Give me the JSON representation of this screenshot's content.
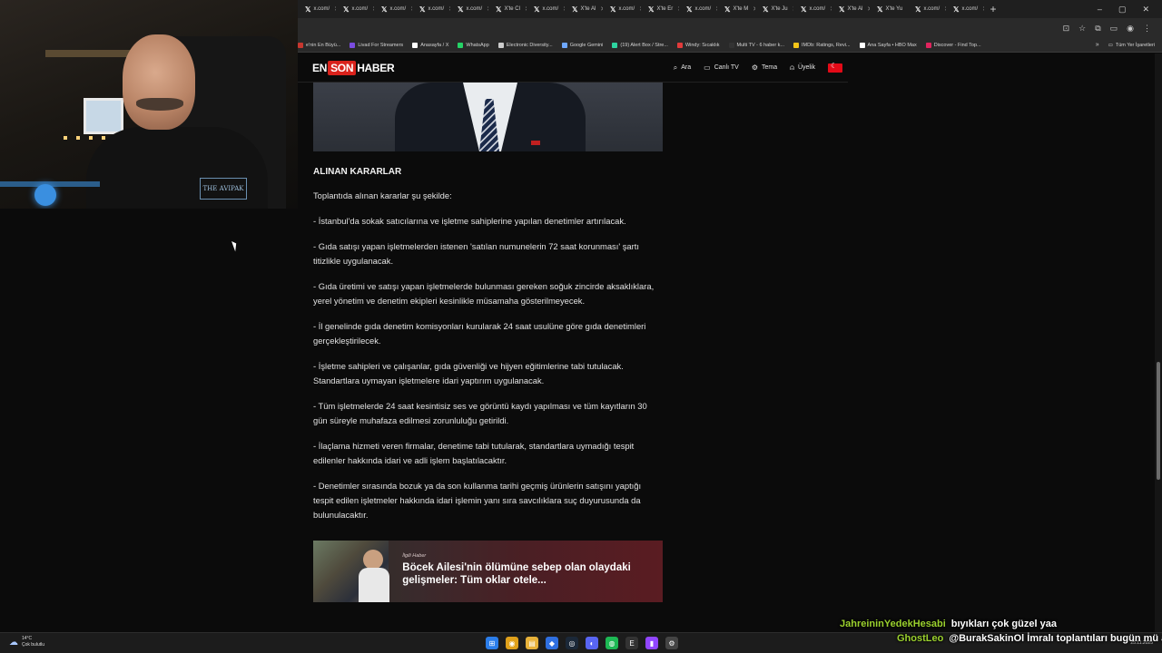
{
  "browser": {
    "tabs": [
      {
        "label": "x.com/"
      },
      {
        "label": "x.com/"
      },
      {
        "label": "x.com/"
      },
      {
        "label": "x.com/"
      },
      {
        "label": "x.com/"
      },
      {
        "label": "X'te Cl"
      },
      {
        "label": "x.com/"
      },
      {
        "label": "X'te Al"
      },
      {
        "label": "x.com/"
      },
      {
        "label": "X'te Er"
      },
      {
        "label": "x.com/"
      },
      {
        "label": "X'te M"
      },
      {
        "label": "X'te Ju"
      },
      {
        "label": "x.com/"
      },
      {
        "label": "X'te Al"
      },
      {
        "label": "X'te Yu"
      },
      {
        "label": "x.com/"
      },
      {
        "label": "x.com/"
      }
    ],
    "bookmarks": [
      {
        "label": "e'nin En Büyü...",
        "color": "#c7372f"
      },
      {
        "label": "Livad For Streamers",
        "color": "#7b4ce0"
      },
      {
        "label": "Anasayfa / X",
        "color": "#ffffff"
      },
      {
        "label": "WhatsApp",
        "color": "#25d366"
      },
      {
        "label": "Electronic Diversity...",
        "color": "#cccccc"
      },
      {
        "label": "Google Gemini",
        "color": "#6ea8ff"
      },
      {
        "label": "(19) Alert Box / Stre...",
        "color": "#2dd4a0"
      },
      {
        "label": "Windy: Sıcaklık",
        "color": "#e23b3b"
      },
      {
        "label": "Multi TV - 6 haber k...",
        "color": "#333333"
      },
      {
        "label": "IMDb: Ratings, Revi...",
        "color": "#f5c518"
      },
      {
        "label": "Ana Sayfa • HBO Max",
        "color": "#ffffff"
      },
      {
        "label": "Discover - Find Top...",
        "color": "#e0245e"
      }
    ],
    "all_bookmarks": "Tüm Yer İşaretleri"
  },
  "site": {
    "logo_en": "EN",
    "logo_son": "SON",
    "logo_haber": "HABER",
    "nav": [
      {
        "label": "Ara",
        "icon": "search-icon",
        "glyph": "⌕"
      },
      {
        "label": "Canlı TV",
        "icon": "tv-icon",
        "glyph": "▭"
      },
      {
        "label": "Tema",
        "icon": "gear-icon",
        "glyph": "⚙"
      },
      {
        "label": "Üyelik",
        "icon": "user-icon",
        "glyph": "⍝"
      }
    ]
  },
  "article": {
    "heading": "ALINAN KARARLAR",
    "intro": "Toplantıda alınan kararlar şu şekilde:",
    "items": [
      "- İstanbul'da sokak satıcılarına ve işletme sahiplerine yapılan denetimler artırılacak.",
      "- Gıda satışı yapan işletmelerden istenen 'satılan numunelerin 72 saat korunması' şartı titizlikle uygulanacak.",
      "- Gıda üretimi ve satışı yapan işletmelerde bulunması gereken soğuk zincirde aksaklıklara, yerel yönetim ve denetim ekipleri kesinlikle müsamaha gösterilmeyecek.",
      "- İl genelinde gıda denetim komisyonları kurularak 24 saat usulüne göre gıda denetimleri gerçekleştirilecek.",
      "- İşletme sahipleri ve çalışanlar, gıda güvenliği ve hijyen eğitimlerine tabi tutulacak. Standartlara uymayan işletmelere idari yaptırım uygulanacak.",
      "- Tüm işletmelerde 24 saat kesintisiz ses ve görüntü kaydı yapılması ve tüm kayıtların 30 gün süreyle muhafaza edilmesi zorunluluğu getirildi.",
      "- İlaçlama hizmeti veren firmalar, denetime tabi tutularak, standartlara uymadığı tespit edilenler hakkında idari ve adli işlem başlatılacaktır.",
      "- Denetimler sırasında bozuk ya da son kullanma tarihi geçmiş ürünlerin satışını yaptığı tespit edilen işletmeler hakkında idari işlemin yanı sıra savcılıklara suç duyurusunda da bulunulacaktır."
    ],
    "related": {
      "label": "İlgili Haber",
      "title": "Böcek Ailesi'nin ölümüne sebep olan olaydaki gelişmeler: Tüm oklar otele..."
    }
  },
  "webcam": {
    "logo_text": "THE AVIPAK"
  },
  "taskbar": {
    "weather_temp": "14°C",
    "weather_desc": "Çok bulutlu",
    "apps": [
      {
        "icon": "windows-start-icon",
        "glyph": "⊞",
        "color": "#2b7de9"
      },
      {
        "icon": "chrome-icon",
        "glyph": "◉",
        "color": "#e0a11b"
      },
      {
        "icon": "file-explorer-icon",
        "glyph": "▤",
        "color": "#e8b23a"
      },
      {
        "icon": "app-icon",
        "glyph": "◆",
        "color": "#2f6fe0"
      },
      {
        "icon": "steam-icon",
        "glyph": "◎",
        "color": "#1b2838"
      },
      {
        "icon": "discord-icon",
        "glyph": "◐",
        "color": "#5865f2"
      },
      {
        "icon": "spotify-icon",
        "glyph": "◍",
        "color": "#1db954"
      },
      {
        "icon": "epic-icon",
        "glyph": "E",
        "color": "#333333"
      },
      {
        "icon": "twitch-icon",
        "glyph": "▮",
        "color": "#9146ff"
      },
      {
        "icon": "settings-icon",
        "glyph": "⚙",
        "color": "#444444"
      }
    ],
    "clock": "25.11.2025"
  },
  "chat": [
    {
      "user": "JahreininYedekHesabi",
      "message": "bıyıkları çok güzel yaa"
    },
    {
      "user": "GhostLeo",
      "message": "@BurakSakinOl İmralı toplantıları bugün mü abi"
    }
  ]
}
